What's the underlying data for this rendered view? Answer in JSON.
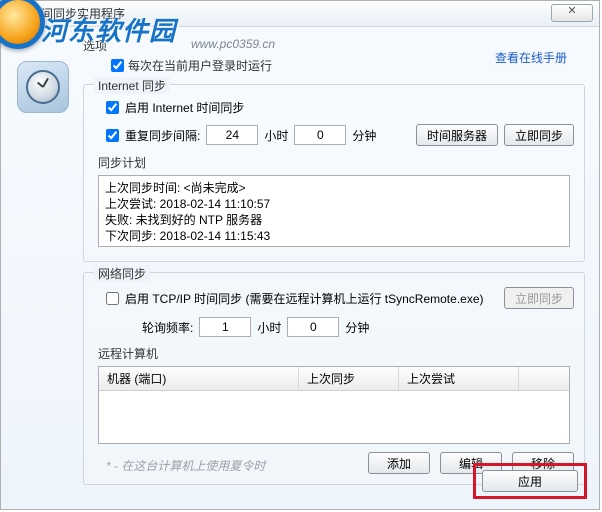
{
  "window": {
    "title": "时间同步实用程序",
    "close_glyph": "✕"
  },
  "watermark": {
    "brand": "河东软件园",
    "url": "www.pc0359.cn"
  },
  "options": {
    "label": "选项",
    "run_on_login_label": "每次在当前用户登录时运行",
    "run_on_login_checked": true,
    "online_manual": "查看在线手册"
  },
  "internet": {
    "legend": "Internet 同步",
    "enable_label": "启用 Internet 时间同步",
    "enable_checked": true,
    "repeat_label": "重复同步间隔:",
    "repeat_checked": true,
    "hours": "24",
    "hours_unit": "小时",
    "minutes": "0",
    "minutes_unit": "分钟",
    "time_server_btn": "时间服务器",
    "sync_now_btn": "立即同步",
    "plan_legend": "同步计划",
    "plan_lines": {
      "l1": "上次同步时间: <尚未完成>",
      "l2": "上次尝试: 2018-02-14 11:10:57",
      "l3": "失败: 未找到好的 NTP 服务器",
      "l4": "下次同步: 2018-02-14 11:15:43"
    }
  },
  "network": {
    "legend": "网络同步",
    "enable_label": "启用 TCP/IP 时间同步 (需要在远程计算机上运行 tSyncRemote.exe)",
    "enable_checked": false,
    "sync_now_btn": "立即同步",
    "poll_label": "轮询频率:",
    "hours": "1",
    "hours_unit": "小时",
    "minutes": "0",
    "minutes_unit": "分钟",
    "remote_legend": "远程计算机",
    "table": {
      "col_machine": "机器 (端口)",
      "col_last_sync": "上次同步",
      "col_last_attempt": "上次尝试"
    },
    "dst_note": "* - 在这台计算机上使用夏令时",
    "add_btn": "添加",
    "edit_btn": "编辑",
    "remove_btn": "移除"
  },
  "footer": {
    "apply_btn": "应用"
  }
}
